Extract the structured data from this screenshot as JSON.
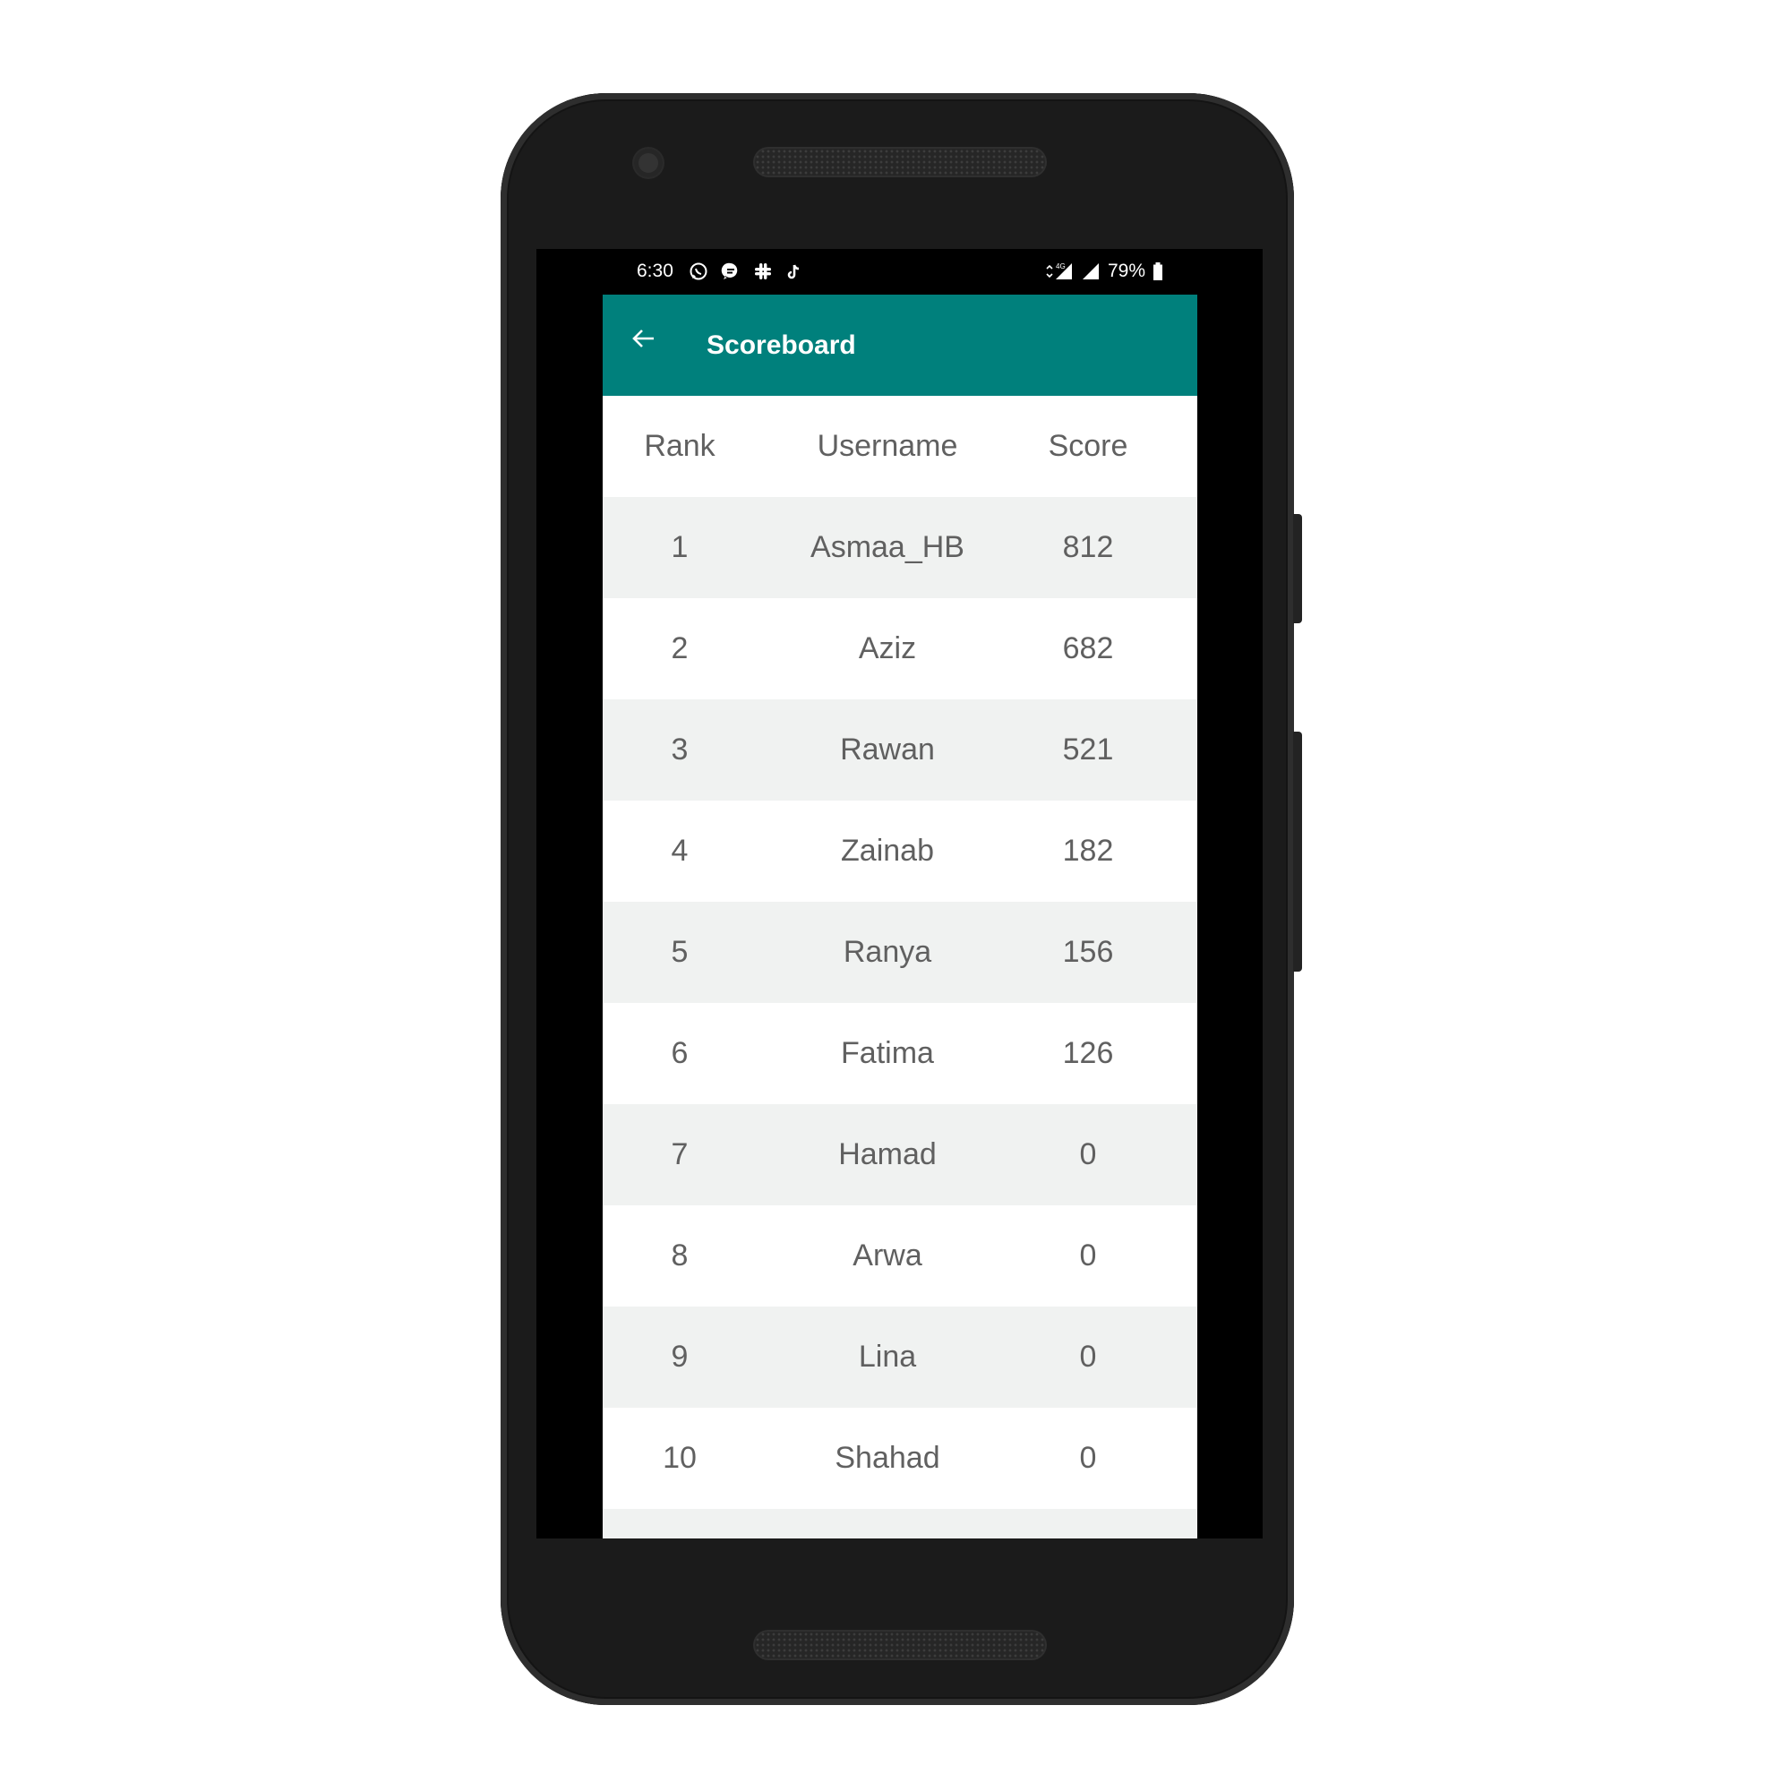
{
  "status_bar": {
    "time": "6:30",
    "notification_icons": [
      "whatsapp-icon",
      "messaging-icon",
      "slack-icon",
      "tiktok-icon"
    ],
    "network": "4G",
    "battery": "79%"
  },
  "app_bar": {
    "title": "Scoreboard",
    "color": "#00807c"
  },
  "table": {
    "headers": {
      "rank": "Rank",
      "username": "Username",
      "score": "Score"
    },
    "rows": [
      {
        "rank": "1",
        "username": "Asmaa_HB",
        "score": "812"
      },
      {
        "rank": "2",
        "username": "Aziz",
        "score": "682"
      },
      {
        "rank": "3",
        "username": "Rawan",
        "score": "521"
      },
      {
        "rank": "4",
        "username": "Zainab",
        "score": "182"
      },
      {
        "rank": "5",
        "username": "Ranya",
        "score": "156"
      },
      {
        "rank": "6",
        "username": "Fatima",
        "score": "126"
      },
      {
        "rank": "7",
        "username": "Hamad",
        "score": "0"
      },
      {
        "rank": "8",
        "username": "Arwa",
        "score": "0"
      },
      {
        "rank": "9",
        "username": "Lina",
        "score": "0"
      },
      {
        "rank": "10",
        "username": "Shahad",
        "score": "0"
      }
    ]
  }
}
